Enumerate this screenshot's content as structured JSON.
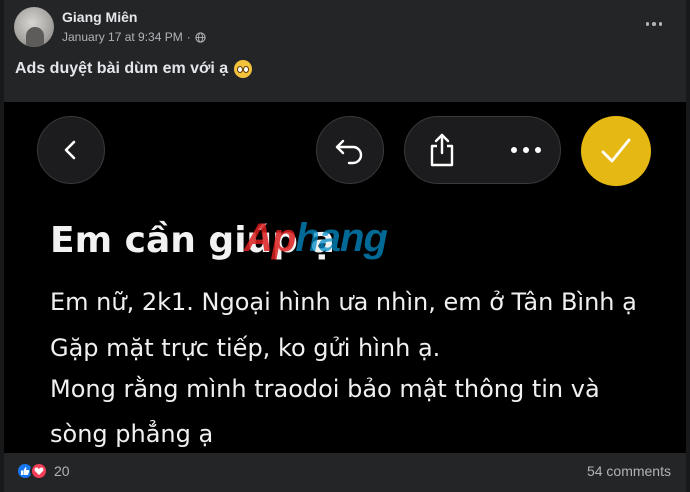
{
  "post": {
    "author": "Giang Miên",
    "timestamp": "January 17 at 9:34 PM",
    "caption": "Ads duyệt bài dùm em với ạ"
  },
  "photo": {
    "heading": "Em cần giúp ạ",
    "watermark_red": "Ap",
    "watermark_blue": "hang",
    "lines": [
      "Em nữ, 2k1. Ngoại hình ưa nhìn, em ở Tân Bình ạ",
      "Gặp mặt trực tiếp, ko gửi hình ạ.",
      "Mong rằng mình traodoi bảo mật thông tin và",
      "sòng phẳng ạ"
    ],
    "accent_color": "#e6b814"
  },
  "footer": {
    "reaction_count": "20",
    "comments": "54 comments"
  }
}
